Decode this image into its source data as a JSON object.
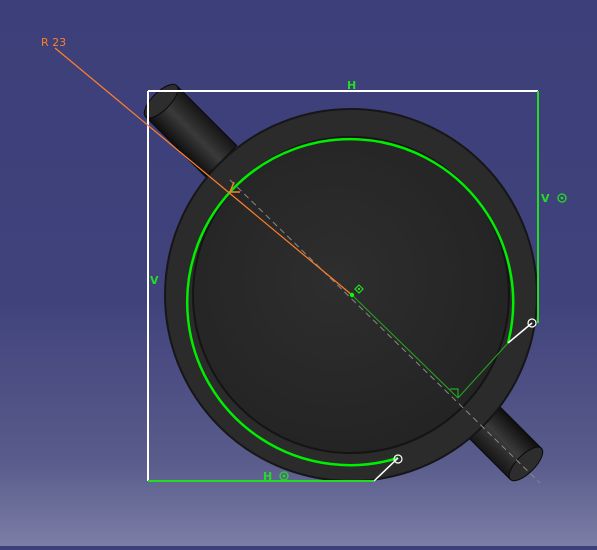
{
  "viewport": {
    "background_top": "#3d3f7a",
    "background_bottom": "#7c7ea6"
  },
  "colors": {
    "constraint_green": "#22cc22",
    "arc_green": "#00ff00",
    "dimension_orange": "#ff7f2a",
    "selection_white": "#ffffff",
    "part_dark": "#2a2a2a",
    "part_edge": "#111111"
  },
  "sketch": {
    "radius_dimension": "R 23",
    "top_constraint": "H",
    "bottom_constraint": "H",
    "left_constraint": "V",
    "right_constraint": "V",
    "center_marker": "◈",
    "tangent_marker": "⊘"
  },
  "icons": {
    "constraint_symbol": "coincident-icon",
    "center_point": "center-point-icon"
  }
}
